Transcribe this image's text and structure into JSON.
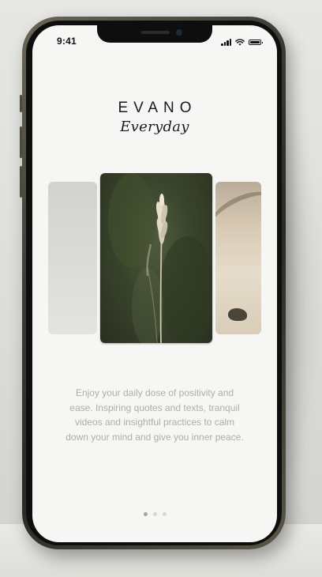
{
  "status_bar": {
    "time": "9:41",
    "icons": [
      "cellular-signal-icon",
      "wifi-icon",
      "battery-icon"
    ]
  },
  "brand": {
    "logo": "EVANO",
    "tagline": "Everyday"
  },
  "carousel": {
    "cards": [
      {
        "name": "card-previous",
        "content": "grey-gradient-image"
      },
      {
        "name": "card-current",
        "content": "grass-stalk-image"
      },
      {
        "name": "card-next",
        "content": "beach-shore-image"
      }
    ],
    "active_index": 1,
    "page_count": 3
  },
  "onboarding": {
    "description": "Enjoy your daily dose of positivity and ease. Inspiring quotes and texts, tranquil videos and insightful practices to calm down your mind and give you inner peace."
  },
  "colors": {
    "background": "#f6f6f4",
    "text_dark": "#1a1a1a",
    "text_muted": "#adadab",
    "dot_active": "#a8a39a",
    "dot_inactive": "#d6d6d3"
  }
}
